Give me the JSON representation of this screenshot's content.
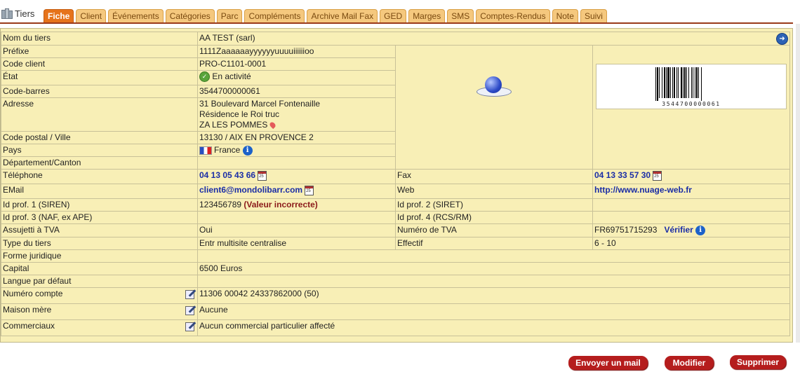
{
  "module_title": "Tiers",
  "tabs": [
    "Fiche",
    "Client",
    "Événements",
    "Catégories",
    "Parc",
    "Compléments",
    "Archive Mail Fax",
    "GED",
    "Marges",
    "SMS",
    "Comptes-Rendus",
    "Note",
    "Suivi"
  ],
  "active_tab": "Fiche",
  "fields": {
    "nom_label": "Nom du tiers",
    "nom_value": "AA TEST (sarl)",
    "prefixe_label": "Préfixe",
    "prefixe_value": "1111Zaaaaaayyyyyyuuuuiiiiiioo",
    "code_client_label": "Code client",
    "code_client_value": "PRO-C1101-0001",
    "etat_label": "État",
    "etat_value": "En activité",
    "codebarres_label": "Code-barres",
    "codebarres_value": "3544700000061",
    "adresse_label": "Adresse",
    "adresse_line1": "31 Boulevard Marcel Fontenaille",
    "adresse_line2": "Résidence le Roi truc",
    "adresse_line3": "ZA LES POMMES",
    "cp_label": "Code postal / Ville",
    "cp_value": "13130 / AIX EN PROVENCE 2",
    "pays_label": "Pays",
    "pays_value": "France",
    "departement_label": "Département/Canton",
    "departement_value": "",
    "telephone_label": "Téléphone",
    "telephone_value": "04 13 05 43 66",
    "fax_label": "Fax",
    "fax_value": "04 13 33 57 30",
    "email_label": "EMail",
    "email_value": "client6@mondolibarr.com",
    "web_label": "Web",
    "web_value": "http://www.nuage-web.fr",
    "idprof1_label": "Id prof. 1 (SIREN)",
    "idprof1_value": "123456789",
    "idprof1_warning": "(Valeur incorrecte)",
    "idprof2_label": "Id prof. 2 (SIRET)",
    "idprof2_value": "",
    "idprof3_label": "Id prof. 3 (NAF, ex APE)",
    "idprof3_value": "",
    "idprof4_label": "Id prof. 4 (RCS/RM)",
    "idprof4_value": "",
    "tva_label": "Assujetti à TVA",
    "tva_value": "Oui",
    "numtva_label": "Numéro de TVA",
    "numtva_value": "FR69751715293",
    "numtva_verify": "Vérifier",
    "type_label": "Type du tiers",
    "type_value": "Entr multisite centralise",
    "effectif_label": "Effectif",
    "effectif_value": "6 - 10",
    "forme_label": "Forme juridique",
    "forme_value": "",
    "capital_label": "Capital",
    "capital_value": "6500 Euros",
    "langue_label": "Langue par défaut",
    "langue_value": "",
    "compte_label": "Numéro compte",
    "compte_value": "11306 00042 24337862000 (50)",
    "maison_label": "Maison mère",
    "maison_value": "Aucune",
    "commerciaux_label": "Commerciaux",
    "commerciaux_value": "Aucun commercial particulier affecté"
  },
  "barcode_digits": "3544700000061",
  "buttons": {
    "send_mail": "Envoyer un mail",
    "modify": "Modifier",
    "delete": "Supprimer"
  },
  "colors": {
    "panel": "#f8efb6",
    "tab": "#f5c87e",
    "tab_active": "#e6731b",
    "button": "#b51d1d",
    "link": "#1a2da6"
  }
}
